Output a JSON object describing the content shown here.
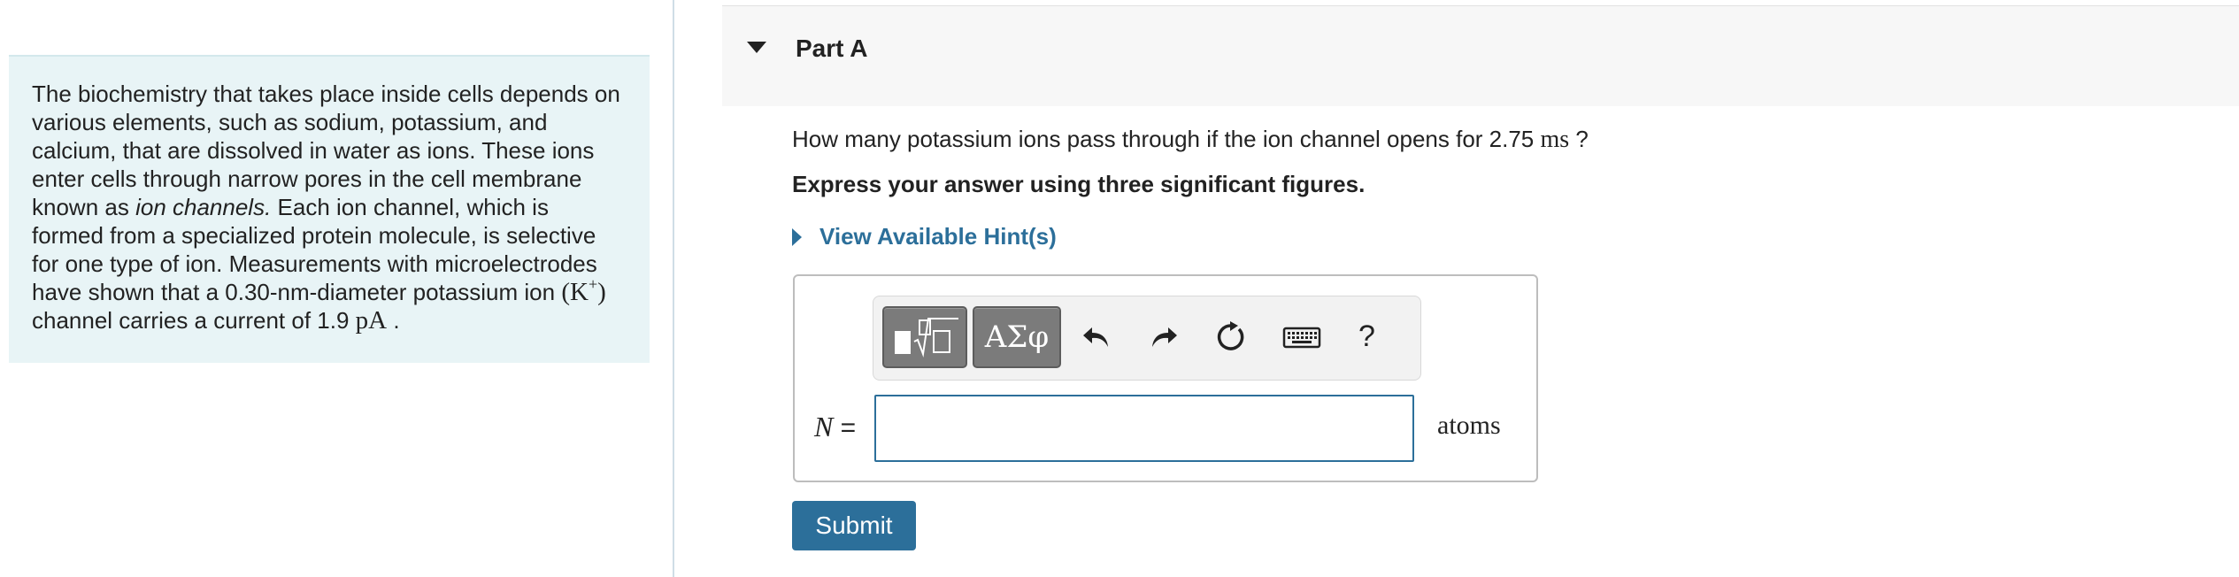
{
  "intro": {
    "lines": [
      "The biochemistry that takes place inside cells depends on",
      "various elements, such as sodium, potassium, and",
      "calcium, that are dissolved in water as ions. These ions",
      "enter cells through narrow pores in the cell membrane"
    ],
    "line5_pre": "known as ",
    "line5_em": "ion channels.",
    "line5_post": " Each ion channel, which is",
    "line6": "formed from a specialized protein molecule, is selective",
    "line7": "for one type of ion. Measurements with microelectrodes",
    "line8_pre": "have shown that a 0.30-nm-diameter potassium ion ",
    "line8_ion_open": "(K",
    "line8_ion_sup": "+",
    "line8_ion_close": ")",
    "line9_pre": "channel carries a current of 1.9 ",
    "line9_unit": "pA",
    "line9_post": " ."
  },
  "part": {
    "title": "Part A"
  },
  "question": {
    "pre": "How many potassium ions pass through if the ion channel opens for 2.75 ",
    "unit": "ms",
    "post": " ?"
  },
  "instruction": "Express your answer using three significant figures.",
  "hint_label": "View Available Hint(s)",
  "toolbar": {
    "greek_label": "ΑΣφ",
    "help_label": "?"
  },
  "answer": {
    "variable": "N",
    "equals": " =",
    "value": "",
    "units": "atoms"
  },
  "submit_label": "Submit",
  "colors": {
    "accent": "#2c6f9a",
    "intro_bg": "#e8f4f6",
    "header_bg": "#f7f7f7",
    "toolbar_btn": "#7b7b7b"
  }
}
